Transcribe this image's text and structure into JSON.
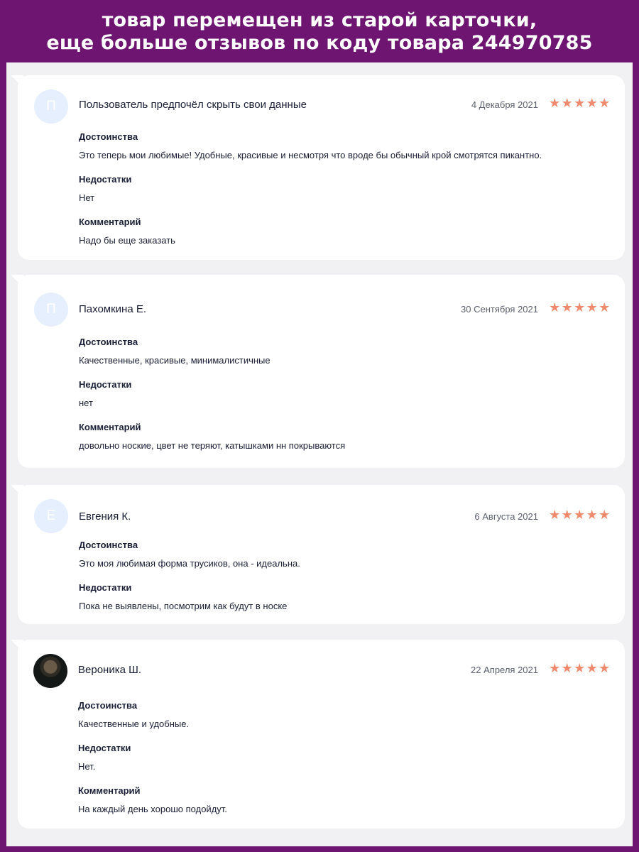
{
  "banner": {
    "line1": "товар перемещен из старой карточки,",
    "line2": "еще больше отзывов по коду товара 244970785"
  },
  "reviews": [
    {
      "initial": "П",
      "name": "Пользователь предпочёл скрыть свои данные",
      "date": "4 Декабря 2021",
      "rating": 5,
      "pros_label": "Достоинства",
      "pros": "Это теперь мои любимые! Удобные, красивые и несмотря что вроде бы обычный крой смотрятся пикантно.",
      "cons_label": "Недостатки",
      "cons": "Нет",
      "comment_label": "Комментарий",
      "comment": "Надо бы еще заказать"
    },
    {
      "initial": "П",
      "name": "Пахомкина Е.",
      "date": "30 Сентября 2021",
      "rating": 5,
      "pros_label": "Достоинства",
      "pros": "Качественные, красивые, минималистичные",
      "cons_label": "Недостатки",
      "cons": "нет",
      "comment_label": "Комментарий",
      "comment": "довольно ноские, цвет не теряют, катышками нн покрываются"
    },
    {
      "initial": "Е",
      "name": "Евгения К.",
      "date": "6 Августа 2021",
      "rating": 5,
      "pros_label": "Достоинства",
      "pros": "Это моя любимая форма трусиков, она - идеальна.",
      "cons_label": "Недостатки",
      "cons": "Пока не выявлены, посмотрим как будут в носке"
    },
    {
      "name": "Вероника Ш.",
      "date": "22 Апреля 2021",
      "rating": 5,
      "pros_label": "Достоинства",
      "pros": "Качественные и удобные.",
      "cons_label": "Недостатки",
      "cons": "Нет.",
      "comment_label": "Комментарий",
      "comment": "На каждый день хорошо подойдут."
    }
  ],
  "colors": {
    "banner_bg": "#6e1471",
    "star": "#f08a6e",
    "avatar_bg": "#e6effd"
  },
  "icons": {
    "star": "star-icon",
    "avatar": "user-avatar"
  }
}
